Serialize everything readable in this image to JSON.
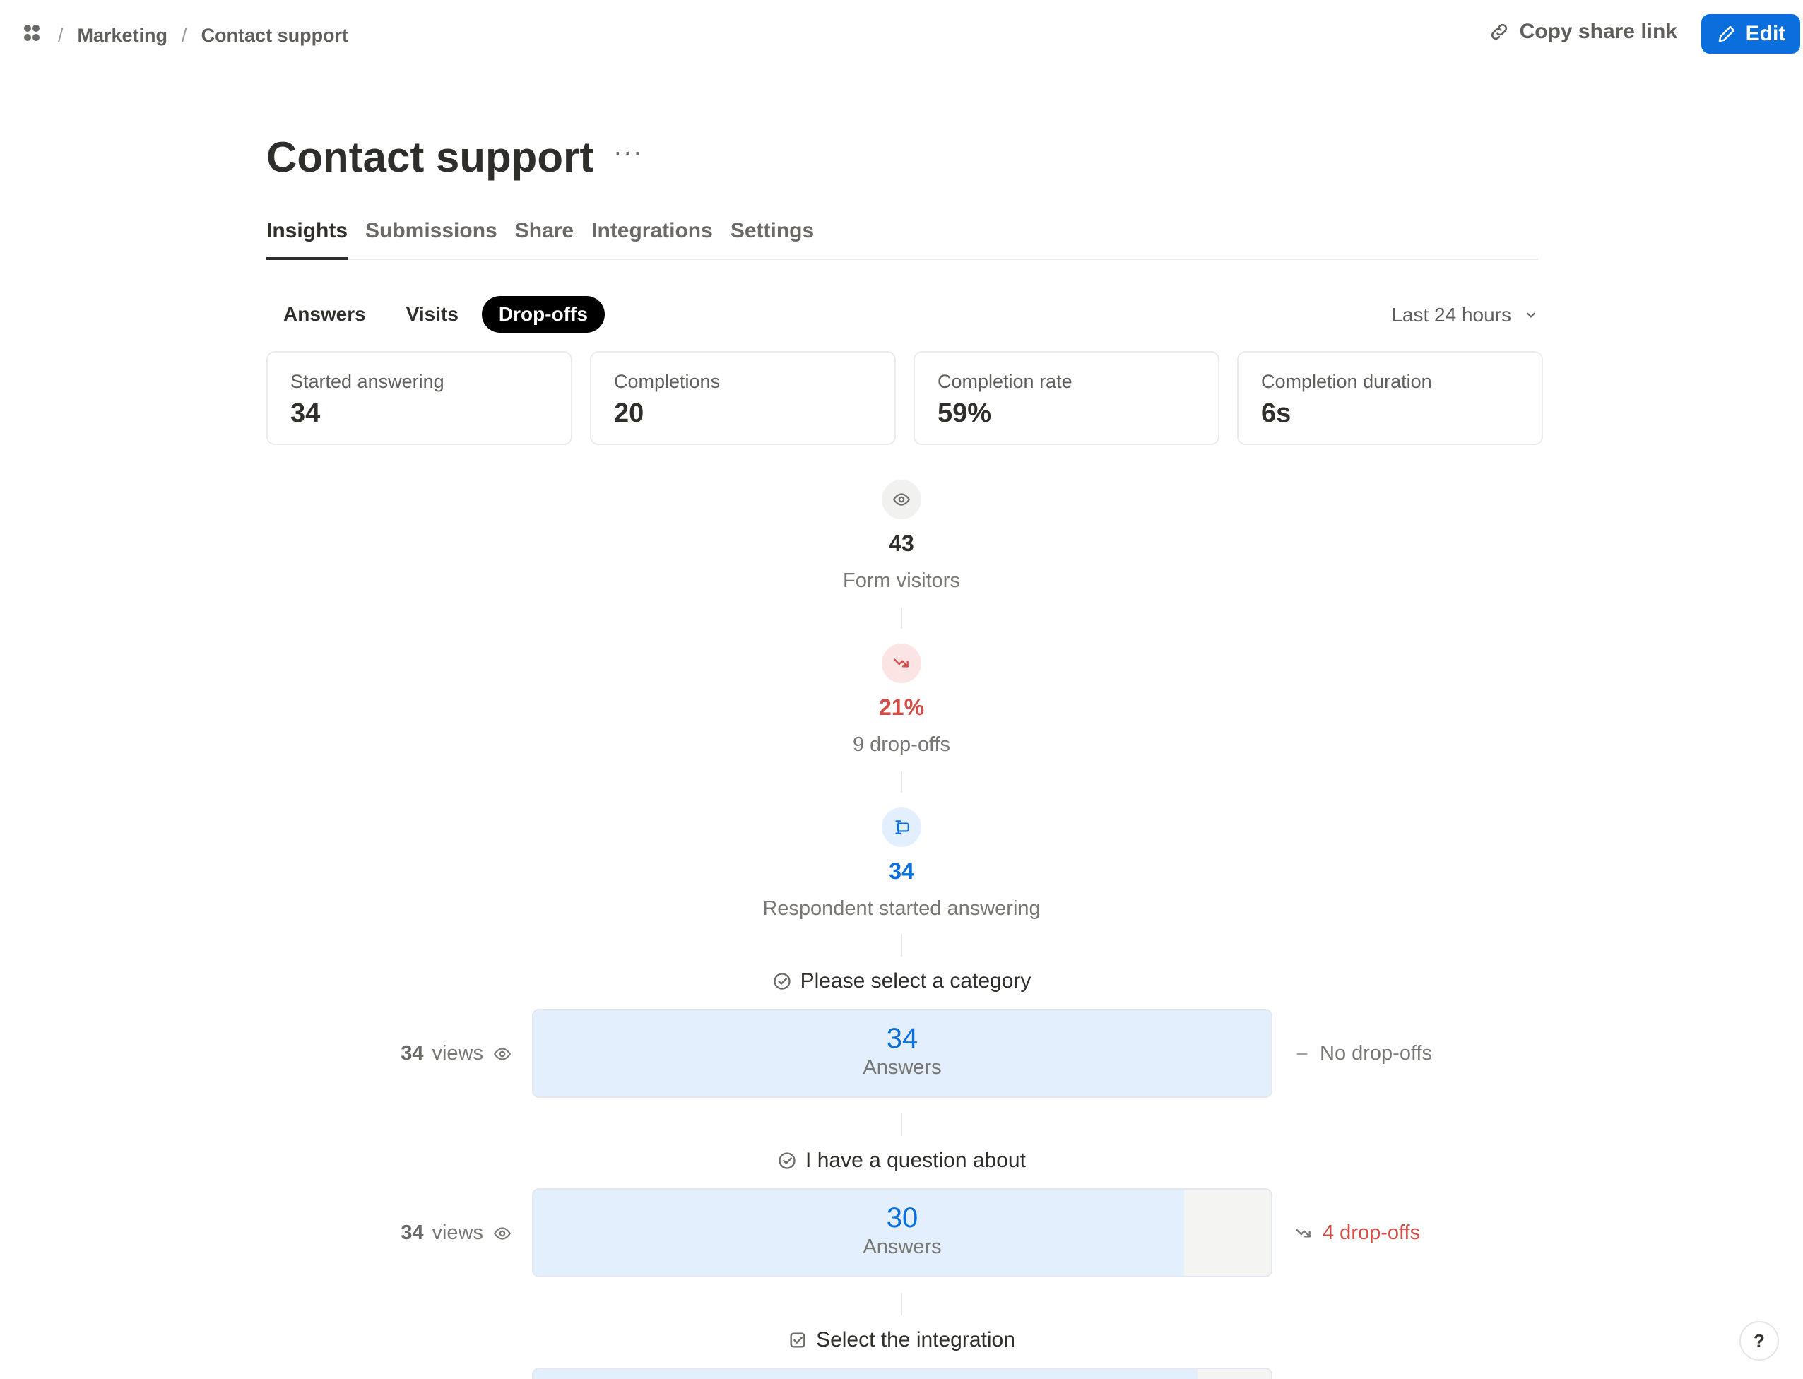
{
  "breadcrumb": {
    "items": [
      "Marketing",
      "Contact support"
    ],
    "separator": "/"
  },
  "header": {
    "share_label": "Copy share link",
    "edit_label": "Edit"
  },
  "page": {
    "title": "Contact support",
    "more": "···"
  },
  "tabs": [
    {
      "label": "Insights",
      "active": true
    },
    {
      "label": "Submissions",
      "active": false
    },
    {
      "label": "Share",
      "active": false
    },
    {
      "label": "Integrations",
      "active": false
    },
    {
      "label": "Settings",
      "active": false
    }
  ],
  "views_toggle": [
    {
      "label": "Answers",
      "active": false
    },
    {
      "label": "Visits",
      "active": false
    },
    {
      "label": "Drop-offs",
      "active": true
    }
  ],
  "time_range": {
    "selected": "Last 24 hours"
  },
  "stats": [
    {
      "label": "Started answering",
      "value": "34"
    },
    {
      "label": "Completions",
      "value": "20"
    },
    {
      "label": "Completion rate",
      "value": "59%"
    },
    {
      "label": "Completion duration",
      "value": "6s"
    }
  ],
  "funnel": {
    "visitors": {
      "value": "43",
      "label": "Form visitors"
    },
    "dropoff": {
      "value": "21%",
      "label": "9 drop-offs"
    },
    "started": {
      "value": "34",
      "label": "Respondent started answering"
    },
    "questions": [
      {
        "title": "Please select a category",
        "views_count": "34",
        "views_label": "views",
        "answers": "34",
        "answers_label": "Answers",
        "answer_fraction": 1.0,
        "dropoff_label": "No drop-offs",
        "has_dropoffs": false
      },
      {
        "title": "I have a question about",
        "views_count": "34",
        "views_label": "views",
        "answers": "30",
        "answers_label": "Answers",
        "answer_fraction": 0.882,
        "dropoff_label": "4 drop-offs",
        "has_dropoffs": true
      },
      {
        "title": "Select the integration",
        "answer_fraction": 0.9
      }
    ]
  },
  "help": {
    "label": "?"
  },
  "colors": {
    "accent": "#0a6fdd",
    "danger": "#d44c47",
    "bar_fill": "#e3effd"
  }
}
